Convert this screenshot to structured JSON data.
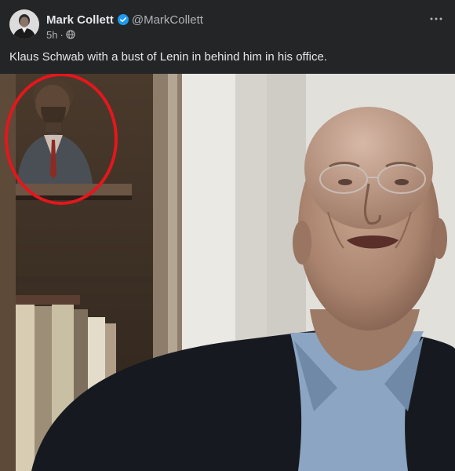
{
  "post": {
    "author_name": "Mark Collett",
    "author_handle": "@MarkCollett",
    "time": "5h",
    "meta_separator": "·",
    "text": "Klaus Schwab with a bust of Lenin in behind him in his office.",
    "verified": true
  },
  "icons": {
    "avatar": "profile-avatar",
    "verified": "verified-badge-icon",
    "audience": "public-globe-icon",
    "more": "more-options-icon"
  },
  "media": {
    "alt": "Klaus Schwab with a bust of Lenin in behind him in his office.",
    "highlight_color": "#e3171c"
  },
  "colors": {
    "background": "#242526",
    "primary_text": "#e4e6eb",
    "secondary_text": "#b0b3b8",
    "verified_blue": "#1d9bf0"
  }
}
